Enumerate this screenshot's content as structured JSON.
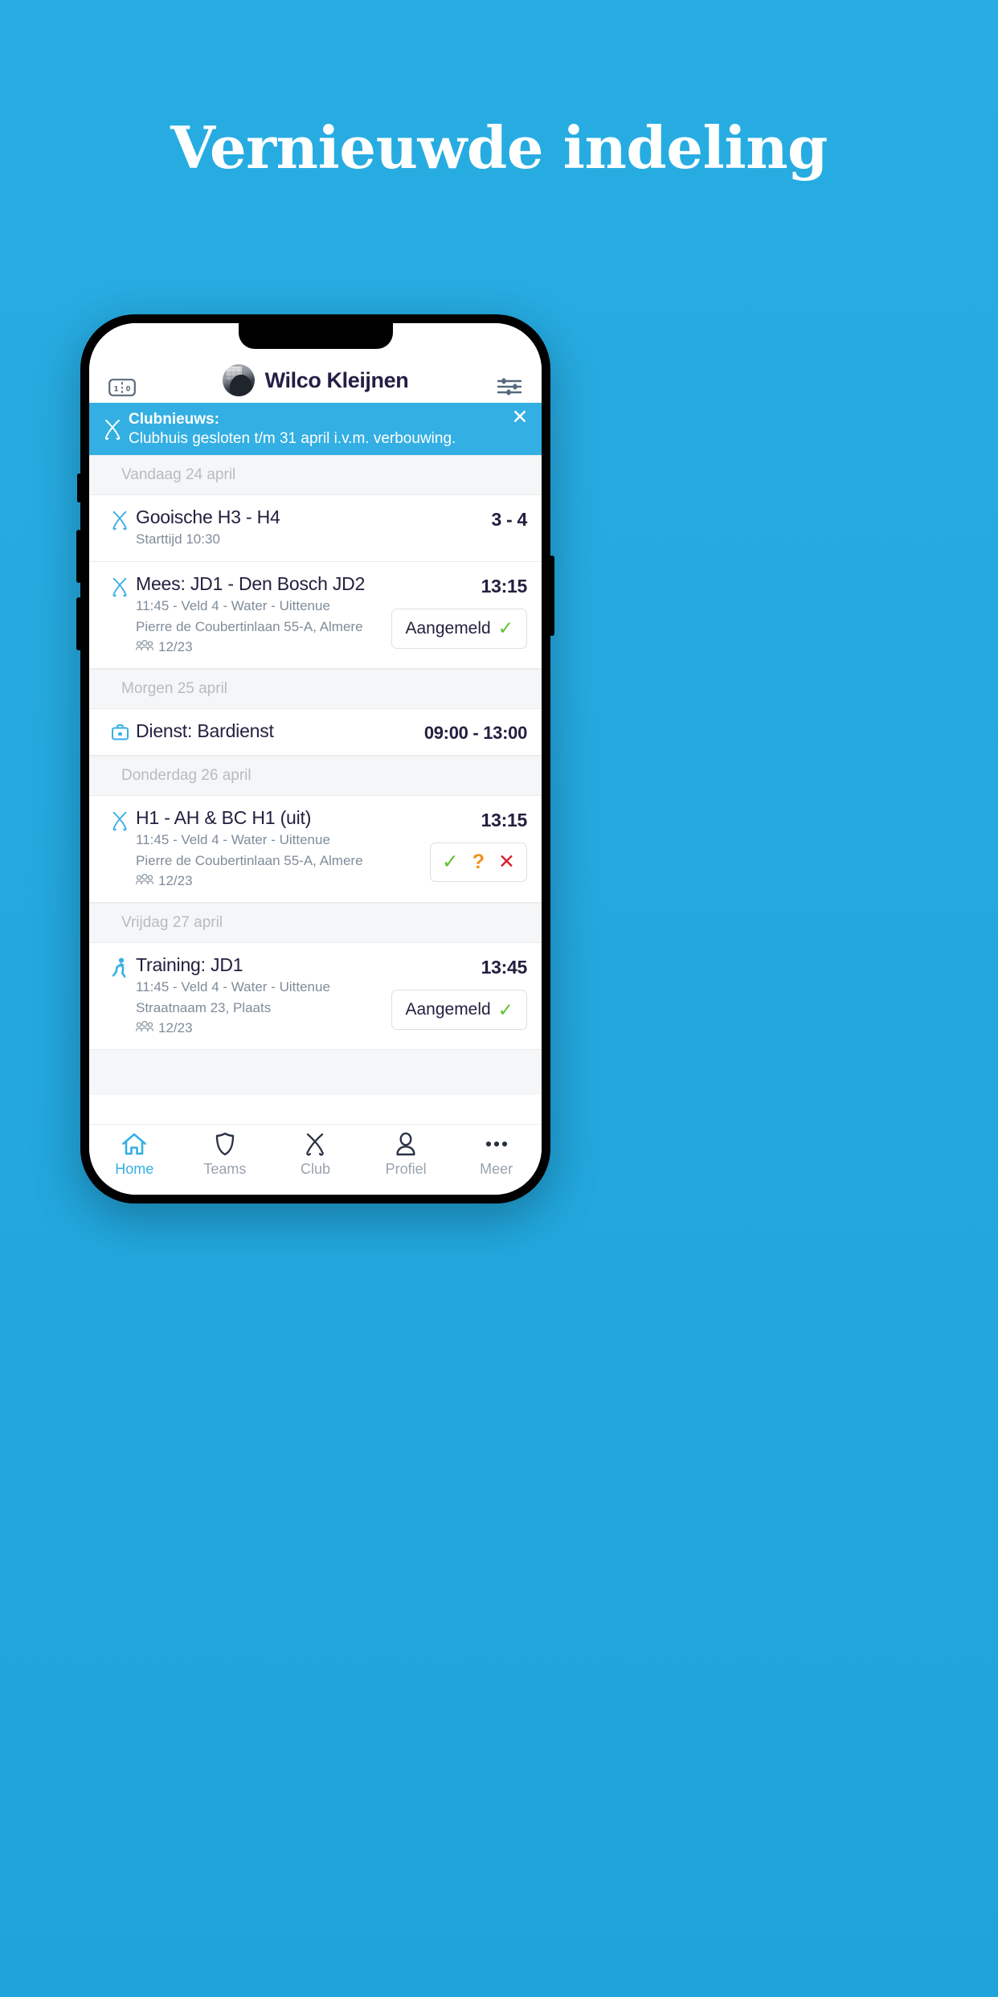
{
  "headline": "Vernieuwde indeling",
  "phone": {
    "header": {
      "scoreboard_icon": "scoreboard-icon",
      "score_left": "1",
      "score_right": "0",
      "user_name": "Wilco Kleijnen",
      "avatar_icon": "user-avatar",
      "settings_icon": "sliders-icon"
    },
    "banner": {
      "icon": "crossed-hockey-sticks-icon",
      "title": "Clubnieuws:",
      "body": "Clubhuis gesloten t/m 31 april i.v.m. verbouwing.",
      "close_icon": "✕",
      "bg_color": "#33AFE3"
    },
    "sections": [
      {
        "day_label": "Vandaag 24 april",
        "events": [
          {
            "icon": "crossed-hockey-sticks-icon",
            "title": "Gooische H3 - H4",
            "lines": [
              "Starttijd 10:30"
            ],
            "right_value": "3 - 4",
            "action": null,
            "attendance": null
          },
          {
            "icon": "crossed-hockey-sticks-icon",
            "title": "Mees: JD1 - Den Bosch JD2",
            "lines": [
              "11:45 - Veld 4 - Water - Uittenue",
              "Pierre de Coubertinlaan 55-A, Almere"
            ],
            "right_value": "13:15",
            "attendance": "12/23",
            "action": {
              "type": "pill",
              "label": "Aangemeld",
              "check": "✓"
            }
          }
        ]
      },
      {
        "day_label": "Morgen 25 april",
        "events": [
          {
            "icon": "briefcase-icon",
            "title": "Dienst: Bardienst",
            "lines": [],
            "right_value": "09:00 - 13:00",
            "attendance": null,
            "action": null
          }
        ]
      },
      {
        "day_label": "Donderdag 26 april",
        "events": [
          {
            "icon": "crossed-hockey-sticks-icon",
            "title": "H1 - AH & BC H1 (uit)",
            "lines": [
              "11:45 - Veld 4 - Water - Uittenue",
              "Pierre de Coubertinlaan 55-A, Almere"
            ],
            "right_value": "13:15",
            "attendance": "12/23",
            "action": {
              "type": "rsvp",
              "yes": "✓",
              "maybe": "?",
              "no": "✕"
            }
          }
        ]
      },
      {
        "day_label": "Vrijdag 27 april",
        "events": [
          {
            "icon": "running-person-icon",
            "title": "Training: JD1",
            "lines": [
              "11:45 - Veld 4 - Water - Uittenue",
              "Straatnaam 23, Plaats"
            ],
            "right_value": "13:45",
            "attendance": "12/23",
            "action": {
              "type": "pill",
              "label": "Aangemeld",
              "check": "✓"
            }
          }
        ]
      }
    ],
    "tabs": [
      {
        "label": "Home",
        "icon": "home-icon",
        "active": true
      },
      {
        "label": "Teams",
        "icon": "shield-icon",
        "active": false
      },
      {
        "label": "Club",
        "icon": "crossed-hockey-sticks-icon",
        "active": false
      },
      {
        "label": "Profiel",
        "icon": "person-icon",
        "active": false
      },
      {
        "label": "Meer",
        "icon": "ellipsis-icon",
        "active": false
      }
    ]
  },
  "colors": {
    "background": "#26ACE0",
    "accent": "#36AFE4",
    "text_dark": "#23203f",
    "text_muted": "#7f8c9a",
    "green": "#5ec22e",
    "orange": "#f0921e",
    "red": "#d91f2e"
  }
}
